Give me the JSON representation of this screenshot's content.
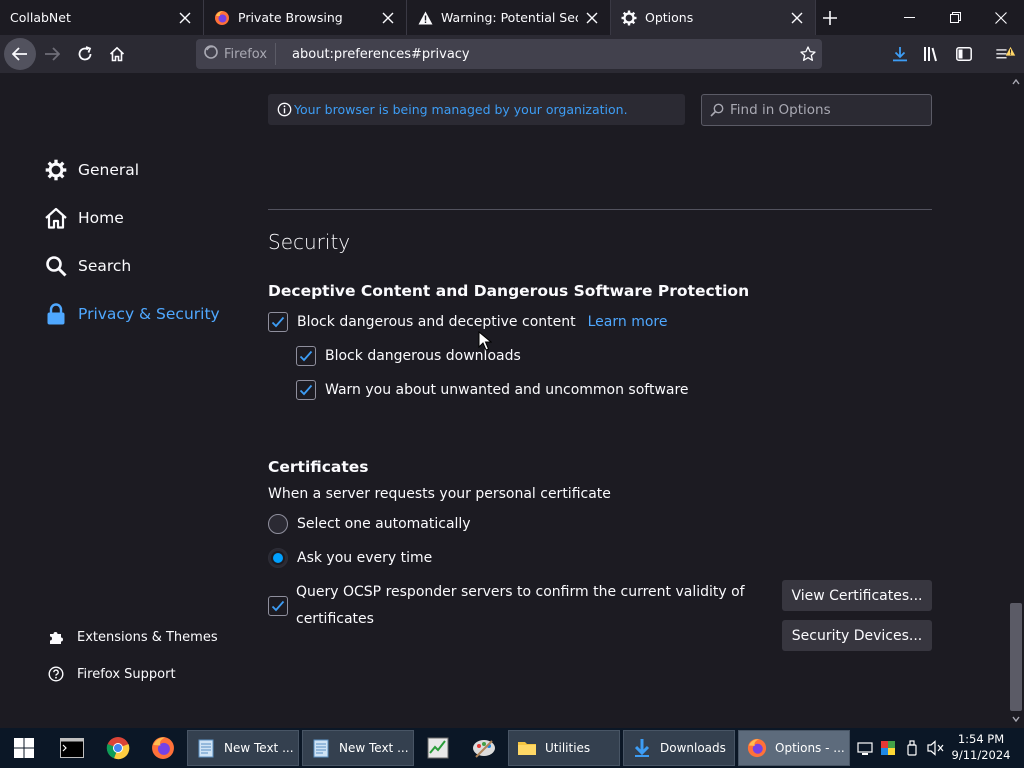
{
  "tabs": [
    {
      "title": "CollabNet"
    },
    {
      "title": "Private Browsing"
    },
    {
      "title": "Warning: Potential Security Risk Ahead"
    },
    {
      "title": "Options"
    }
  ],
  "navbar": {
    "identity_label": "Firefox",
    "url": "about:preferences#privacy"
  },
  "policies": {
    "text": "Your browser is being managed by your organization."
  },
  "search": {
    "placeholder": "Find in Options"
  },
  "sidebar": {
    "items": [
      {
        "label": "General"
      },
      {
        "label": "Home"
      },
      {
        "label": "Search"
      },
      {
        "label": "Privacy & Security"
      }
    ],
    "footer": [
      {
        "label": "Extensions & Themes"
      },
      {
        "label": "Firefox Support"
      }
    ]
  },
  "security": {
    "heading": "Security",
    "deceptive": {
      "title": "Deceptive Content and Dangerous Software Protection",
      "block_dangerous": "Block dangerous and deceptive content",
      "learn_more": "Learn more",
      "block_downloads": "Block dangerous downloads",
      "warn_unwanted": "Warn you about unwanted and uncommon software"
    },
    "certificates": {
      "title": "Certificates",
      "desc": "When a server requests your personal certificate",
      "select_auto": "Select one automatically",
      "ask_every": "Ask you every time",
      "ocsp_line1": "Query OCSP responder servers to confirm the current validity of",
      "ocsp_line2": "certificates",
      "view_certs": "View Certificates...",
      "security_devices": "Security Devices..."
    }
  },
  "taskbar": {
    "items": [
      {
        "label": "New Text ..."
      },
      {
        "label": "New Text ..."
      },
      {
        "label": "Utilities"
      },
      {
        "label": "Downloads"
      },
      {
        "label": "Options - ..."
      }
    ],
    "time": "1:54 PM",
    "date": "9/11/2024"
  },
  "colors": {
    "accent": "#00a0ff",
    "link": "#4fa8ff",
    "background": "#1c1b22",
    "toolbar": "#2b2a33"
  }
}
